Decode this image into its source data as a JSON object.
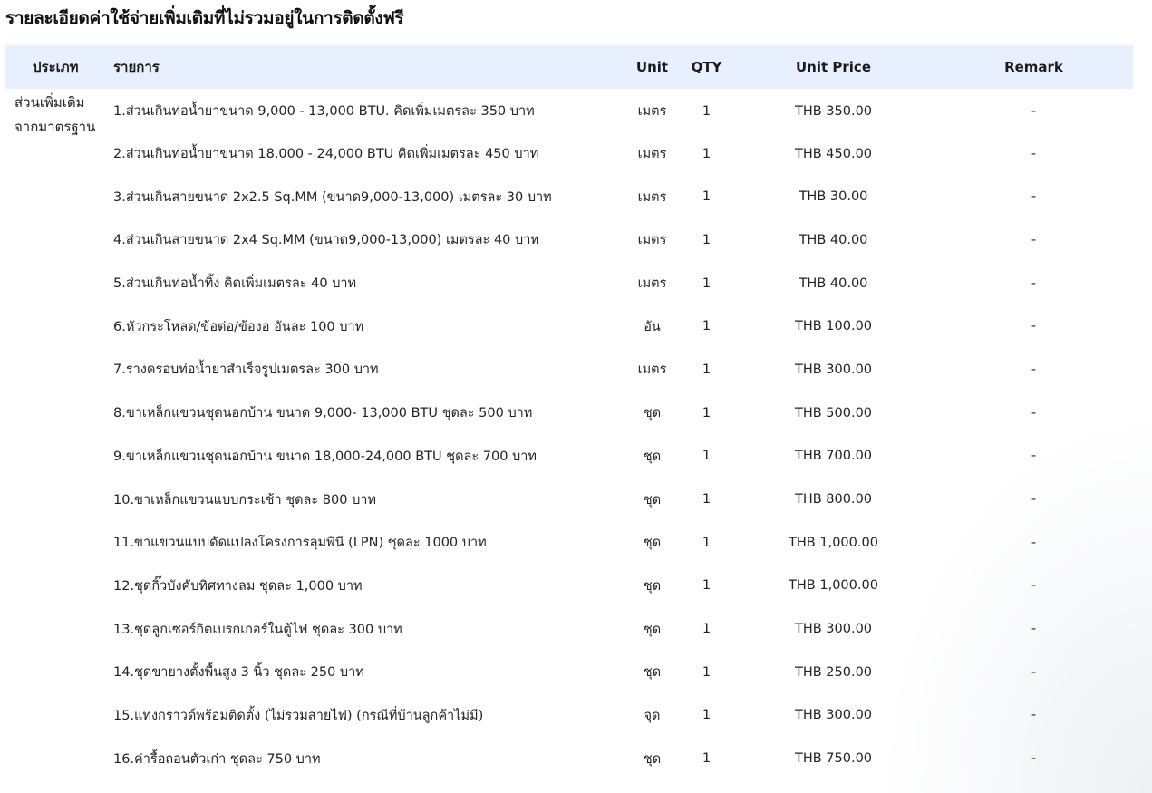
{
  "section": {
    "title": "รายละเอียดค่าใช้จ่ายเพิ่มเติมที่ไม่รวมอยู่ในการติดตั้งฟรี"
  },
  "table": {
    "headers": {
      "type": "ประเภท",
      "item": "รายการ",
      "unit": "Unit",
      "qty": "QTY",
      "unit_price": "Unit Price",
      "remark": "Remark"
    },
    "category": "ส่วนเพิ่มเติม จากมาตรฐาน",
    "rows": [
      {
        "item": "1.ส่วนเกินท่อน้ำยาขนาด 9,000 - 13,000 BTU. คิดเพิ่มเมตรละ 350 บาท",
        "unit": "เมตร",
        "qty": "1",
        "price": "THB 350.00",
        "remark": "-"
      },
      {
        "item": "2.ส่วนเกินท่อน้ำยาขนาด 18,000 - 24,000 BTU คิดเพิ่มเมตรละ 450 บาท",
        "unit": "เมตร",
        "qty": "1",
        "price": "THB 450.00",
        "remark": "-"
      },
      {
        "item": "3.ส่วนเกินสายขนาด 2x2.5 Sq.MM (ขนาด9,000-13,000) เมตรละ 30 บาท",
        "unit": "เมตร",
        "qty": "1",
        "price": "THB 30.00",
        "remark": "-"
      },
      {
        "item": "4.ส่วนเกินสายขนาด 2x4 Sq.MM (ขนาด9,000-13,000) เมตรละ 40 บาท",
        "unit": "เมตร",
        "qty": "1",
        "price": "THB 40.00",
        "remark": "-"
      },
      {
        "item": "5.ส่วนเกินท่อน้ำทิ้ง คิดเพิ่มเมตรละ 40 บาท",
        "unit": "เมตร",
        "qty": "1",
        "price": "THB 40.00",
        "remark": "-"
      },
      {
        "item": "6.หัวกระโหลด/ข้อต่อ/ข้องอ อันละ 100 บาท",
        "unit": "อัน",
        "qty": "1",
        "price": "THB 100.00",
        "remark": "-"
      },
      {
        "item": "7.รางครอบท่อน้ำยาสำเร็จรูปเมตรละ 300 บาท",
        "unit": "เมตร",
        "qty": "1",
        "price": "THB 300.00",
        "remark": "-"
      },
      {
        "item": "8.ขาเหล็กแขวนชุดนอกบ้าน ขนาด 9,000- 13,000 BTU ชุดละ 500 บาท",
        "unit": "ชุด",
        "qty": "1",
        "price": "THB 500.00",
        "remark": "-"
      },
      {
        "item": "9.ขาเหล็กแขวนชุดนอกบ้าน ขนาด 18,000-24,000 BTU ชุดละ 700 บาท",
        "unit": "ชุด",
        "qty": "1",
        "price": "THB 700.00",
        "remark": "-"
      },
      {
        "item": "10.ขาเหล็กแขวนแบบกระเช้า ชุดละ 800 บาท",
        "unit": "ชุด",
        "qty": "1",
        "price": "THB 800.00",
        "remark": "-"
      },
      {
        "item": "11.ขาแขวนแบบดัดแปลงโครงการลุมพินี (LPN) ชุดละ 1000 บาท",
        "unit": "ชุด",
        "qty": "1",
        "price": "THB 1,000.00",
        "remark": "-"
      },
      {
        "item": "12.ชุดกิ๊วบังคับทิศทางลม ชุดละ 1,000 บาท",
        "unit": "ชุด",
        "qty": "1",
        "price": "THB 1,000.00",
        "remark": "-"
      },
      {
        "item": "13.ชุดลูกเซอร์กิตเบรกเกอร์ในตู้ไฟ ชุดละ 300 บาท",
        "unit": "ชุด",
        "qty": "1",
        "price": "THB 300.00",
        "remark": "-"
      },
      {
        "item": "14.ชุดขายางตั้งพื้นสูง 3 นิ้ว ชุดละ 250 บาท",
        "unit": "ชุด",
        "qty": "1",
        "price": "THB 250.00",
        "remark": "-"
      },
      {
        "item": "15.แท่งกราวด์พร้อมติดตั้ง (ไม่รวมสายไฟ) (กรณีที่บ้านลูกค้าไม่มี)",
        "unit": "จุด",
        "qty": "1",
        "price": "THB 300.00",
        "remark": "-"
      },
      {
        "item": "16.ค่ารื้อถอนตัวเก่า ชุดละ 750 บาท",
        "unit": "ชุด",
        "qty": "1",
        "price": "THB 750.00",
        "remark": "-"
      }
    ]
  },
  "colors": {
    "header_bg": "#e8efff",
    "text": "#222222"
  }
}
